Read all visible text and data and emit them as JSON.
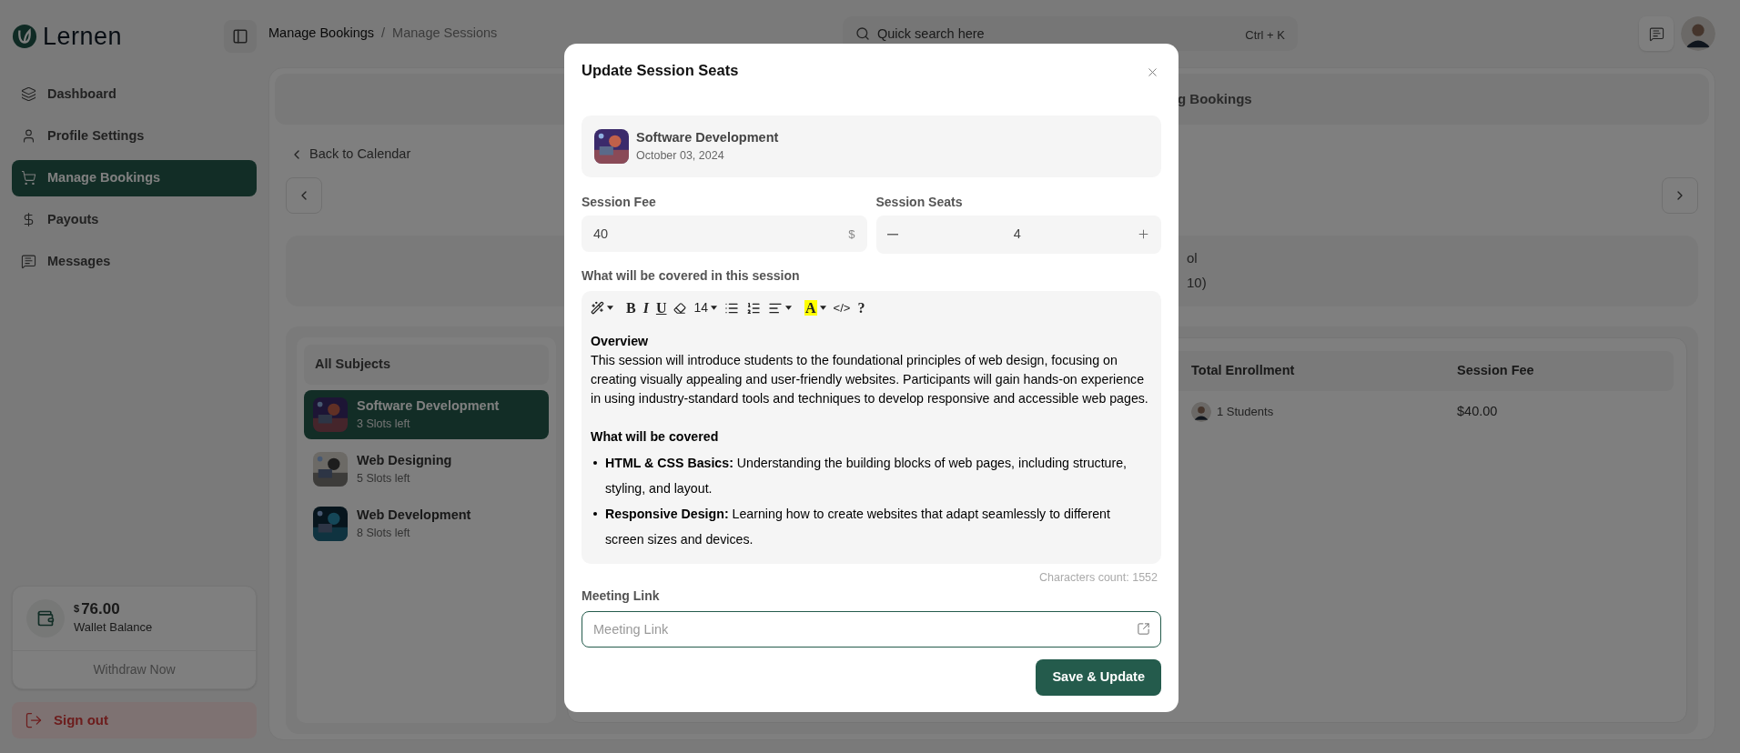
{
  "sidebar": {
    "logo": "Lernen",
    "items": [
      {
        "label": "Dashboard",
        "kind": "layers",
        "selected": false
      },
      {
        "label": "Profile Settings",
        "kind": "user",
        "selected": false
      },
      {
        "label": "Manage Bookings",
        "kind": "cart",
        "selected": true
      },
      {
        "label": "Payouts",
        "kind": "dollar",
        "selected": false
      },
      {
        "label": "Messages",
        "kind": "message",
        "selected": false
      }
    ],
    "wallet": {
      "currency": "$",
      "amount": "76.00",
      "label": "Wallet Balance",
      "action": "Withdraw Now"
    },
    "sign_out": "Sign out"
  },
  "topbar": {
    "breadcrumb": [
      "Manage Bookings",
      "Manage Sessions"
    ],
    "separator": "/",
    "search": {
      "placeholder": "Quick search here",
      "shortcut": "Ctrl + K"
    }
  },
  "main": {
    "tab_partial": "g Bookings",
    "back_link": "Back to Calendar",
    "summary": [
      "ol",
      "10)"
    ],
    "subjects_title": "All Subjects",
    "subjects": [
      {
        "name": "Software Development",
        "slots": "3 Slots left",
        "selected": true
      },
      {
        "name": "Web Designing",
        "slots": "5 Slots left",
        "selected": false
      },
      {
        "name": "Web Development",
        "slots": "8 Slots left",
        "selected": false
      }
    ],
    "table": {
      "columns": [
        "Total Enrollment",
        "Session Fee"
      ],
      "rows": [
        {
          "enrollment": "1 Students",
          "fee": "$40.00"
        }
      ]
    }
  },
  "modal": {
    "title": "Update Session Seats",
    "session": {
      "name": "Software Development",
      "date": "October 03, 2024"
    },
    "fee": {
      "label": "Session Fee",
      "value": "40",
      "unit": "$"
    },
    "seats": {
      "label": "Session Seats",
      "value": "4"
    },
    "editor": {
      "label": "What will be covered in this session",
      "toolbar": [
        {
          "kind": "wand",
          "caret": true
        },
        {
          "kind": "bold",
          "label": "B",
          "caret": false
        },
        {
          "kind": "italic",
          "label": "I",
          "caret": false
        },
        {
          "kind": "underline",
          "label": "U",
          "caret": false
        },
        {
          "kind": "eraser",
          "caret": false
        },
        {
          "kind": "size",
          "label": "14",
          "caret": true
        },
        {
          "kind": "bullets",
          "caret": false
        },
        {
          "kind": "numbers",
          "caret": false
        },
        {
          "kind": "align",
          "caret": true
        },
        {
          "kind": "highlight",
          "label": "A",
          "caret": true
        },
        {
          "kind": "code",
          "label": "</>",
          "caret": false
        },
        {
          "kind": "help",
          "label": "?",
          "caret": false
        }
      ],
      "blocks": [
        {
          "kind": "heading",
          "text": "Overview"
        },
        {
          "kind": "paragraph",
          "text": "This session will introduce students to the foundational principles of web design, focusing on creating visually appealing and user-friendly websites. Participants will gain hands-on experience in using industry-standard tools and techniques to develop responsive and accessible web pages."
        },
        {
          "kind": "heading",
          "text": "What will be covered"
        },
        {
          "kind": "bullet",
          "text": "**HTML & CSS Basics:** Understanding the building blocks of web pages, including structure, styling, and layout."
        },
        {
          "kind": "bullet",
          "text": "**Responsive Design:** Learning how to create websites that adapt seamlessly to different screen sizes and devices."
        }
      ],
      "count_label": "Characters count:",
      "count": "1552"
    },
    "meeting": {
      "label": "Meeting Link",
      "placeholder": "Meeting Link"
    },
    "submit": "Save & Update"
  }
}
